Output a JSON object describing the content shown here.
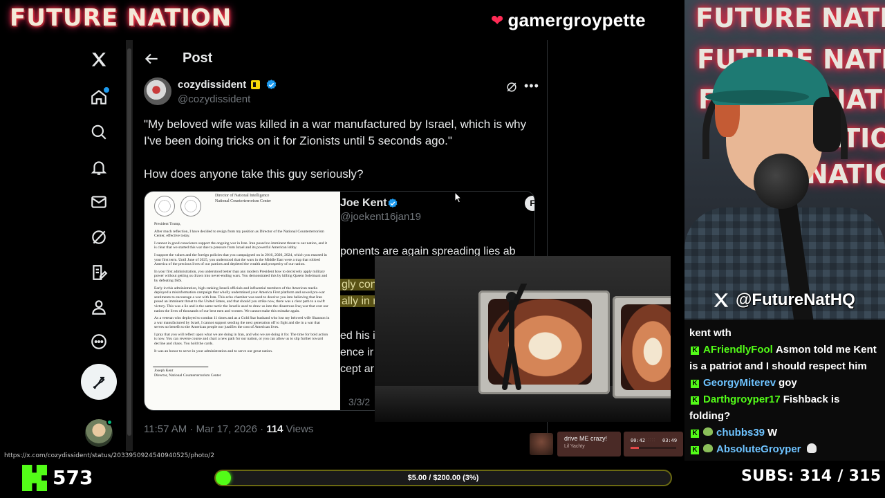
{
  "overlay": {
    "brand": "FUTURE NATION",
    "channel_name": "gamergroypette",
    "social_handle": "@FutureNatHQ",
    "wall_text": [
      "FUTURE NATION",
      "FUTURE NATION",
      "FUTURE NATION",
      "NATION",
      "NATION"
    ]
  },
  "x": {
    "header_title": "Post",
    "author": {
      "name": "cozydissident",
      "handle": "@cozydissident"
    },
    "tweet_paragraphs": [
      "\"My beloved wife was killed in a war manufactured by Israel, which is why I've been doing tricks on it for Zionists until 5 seconds ago.\"",
      "How does anyone take this guy seriously?"
    ],
    "letter": {
      "org_line1": "Director of National Intelligence",
      "org_line2": "National Counterterrorism Center",
      "salutation": "President Trump,",
      "paragraphs": [
        "After much reflection, I have decided to resign from my position as Director of the National Counterterrorism Center, effective today.",
        "I cannot in good conscience support the ongoing war in Iran. Iran posed no imminent threat to our nation, and it is clear that we started this war due to pressure from Israel and its powerful American lobby.",
        "I support the values and the foreign policies that you campaigned on in 2016, 2020, 2024, which you enacted in your first term. Until June of 2025, you understood that the wars in the Middle East were a trap that robbed America of the precious lives of our patriots and depleted the wealth and prosperity of our nation.",
        "In your first administration, you understood better than any modern President how to decisively apply military power without getting us drawn into never-ending wars. You demonstrated this by killing Qasem Soleimani and by defeating ISIS.",
        "Early in this administration, high-ranking Israeli officials and influential members of the American media deployed a misinformation campaign that wholly undermined your America First platform and sowed pro-war sentiments to encourage a war with Iran. This echo chamber was used to deceive you into believing that Iran posed an imminent threat to the United States, and that should you strike now, there was a clear path to a swift victory. This was a lie and is the same tactic the Israelis used to draw us into the disastrous Iraq war that cost our nation the lives of thousands of our best men and women. We cannot make this mistake again.",
        "As a veteran who deployed to combat 11 times and as a Gold Star husband who lost my beloved wife Shannon in a war manufactured by Israel, I cannot support sending the next generation off to fight and die in a war that serves no benefit to the American people nor justifies the cost of American lives.",
        "I pray that you will reflect upon what we are doing in Iran, and who we are doing it for. The time for bold action is now. You can reverse course and chart a new path for our nation, or you can allow us to slip further toward decline and chaos. You hold the cards.",
        "It was an honor to serve in your administration and to serve our great nation."
      ],
      "signer_name": "Joseph Kent",
      "signer_title": "Director, National Counterterrorism Center"
    },
    "quote": {
      "name": "Joe Kent",
      "handle": "@joekent16jan19",
      "fragments": [
        "ponents are again spreading lies ab",
        "gly con",
        "ally in r",
        "ed his i",
        "ence ir",
        "cept ar"
      ],
      "date": "3/3/2"
    },
    "timestamp": "11:57 AM · Mar 17, 2026 · ",
    "views_count": "114",
    "views_label": " Views"
  },
  "browser": {
    "status_url": "https://x.com/cozydissident/status/2033950924540940525/photo/2"
  },
  "chat": {
    "messages": [
      {
        "user": "",
        "text": "kent wth",
        "badge": "none"
      },
      {
        "user": "AFriendlyFool",
        "text": "Asmon told me Kent is a patriot and I should respect him",
        "badge": "kick",
        "color": "green"
      },
      {
        "user": "GeorgyMiterev",
        "text": "goy",
        "badge": "kick",
        "color": "blue"
      },
      {
        "user": "Darthgroyper17",
        "text": "Fishback is folding?",
        "badge": "kick",
        "color": "green"
      },
      {
        "user": "chubbs39",
        "text": "W",
        "badge": "kick-frog",
        "color": "blue"
      },
      {
        "user": "AbsoluteGroyper",
        "text": "",
        "badge": "kick-frog",
        "color": "blue",
        "emote": "skull"
      }
    ]
  },
  "music": {
    "song": "drive ME crazy!",
    "artist": "Lil Yachty",
    "elapsed": "00:42",
    "duration": "03:49",
    "progress": 0.18
  },
  "stream": {
    "followers": "573",
    "goal_label": "$5.00 / $200.00 (3%)",
    "goal_progress": 0.03,
    "subs": "SUBS:  314 / 315"
  },
  "colors": {
    "kick_green": "#53fc18",
    "x_blue": "#1d9bf0",
    "accent_red": "#ff2b55"
  },
  "icons": [
    "x-logo-icon",
    "home-icon",
    "search-icon",
    "bell-icon",
    "mail-icon",
    "grok-icon",
    "edit-list-icon",
    "profile-icon",
    "more-circle-icon",
    "compose-icon",
    "back-arrow-icon",
    "verified-icon",
    "more-icon",
    "heart-icon",
    "kick-logo-icon"
  ]
}
